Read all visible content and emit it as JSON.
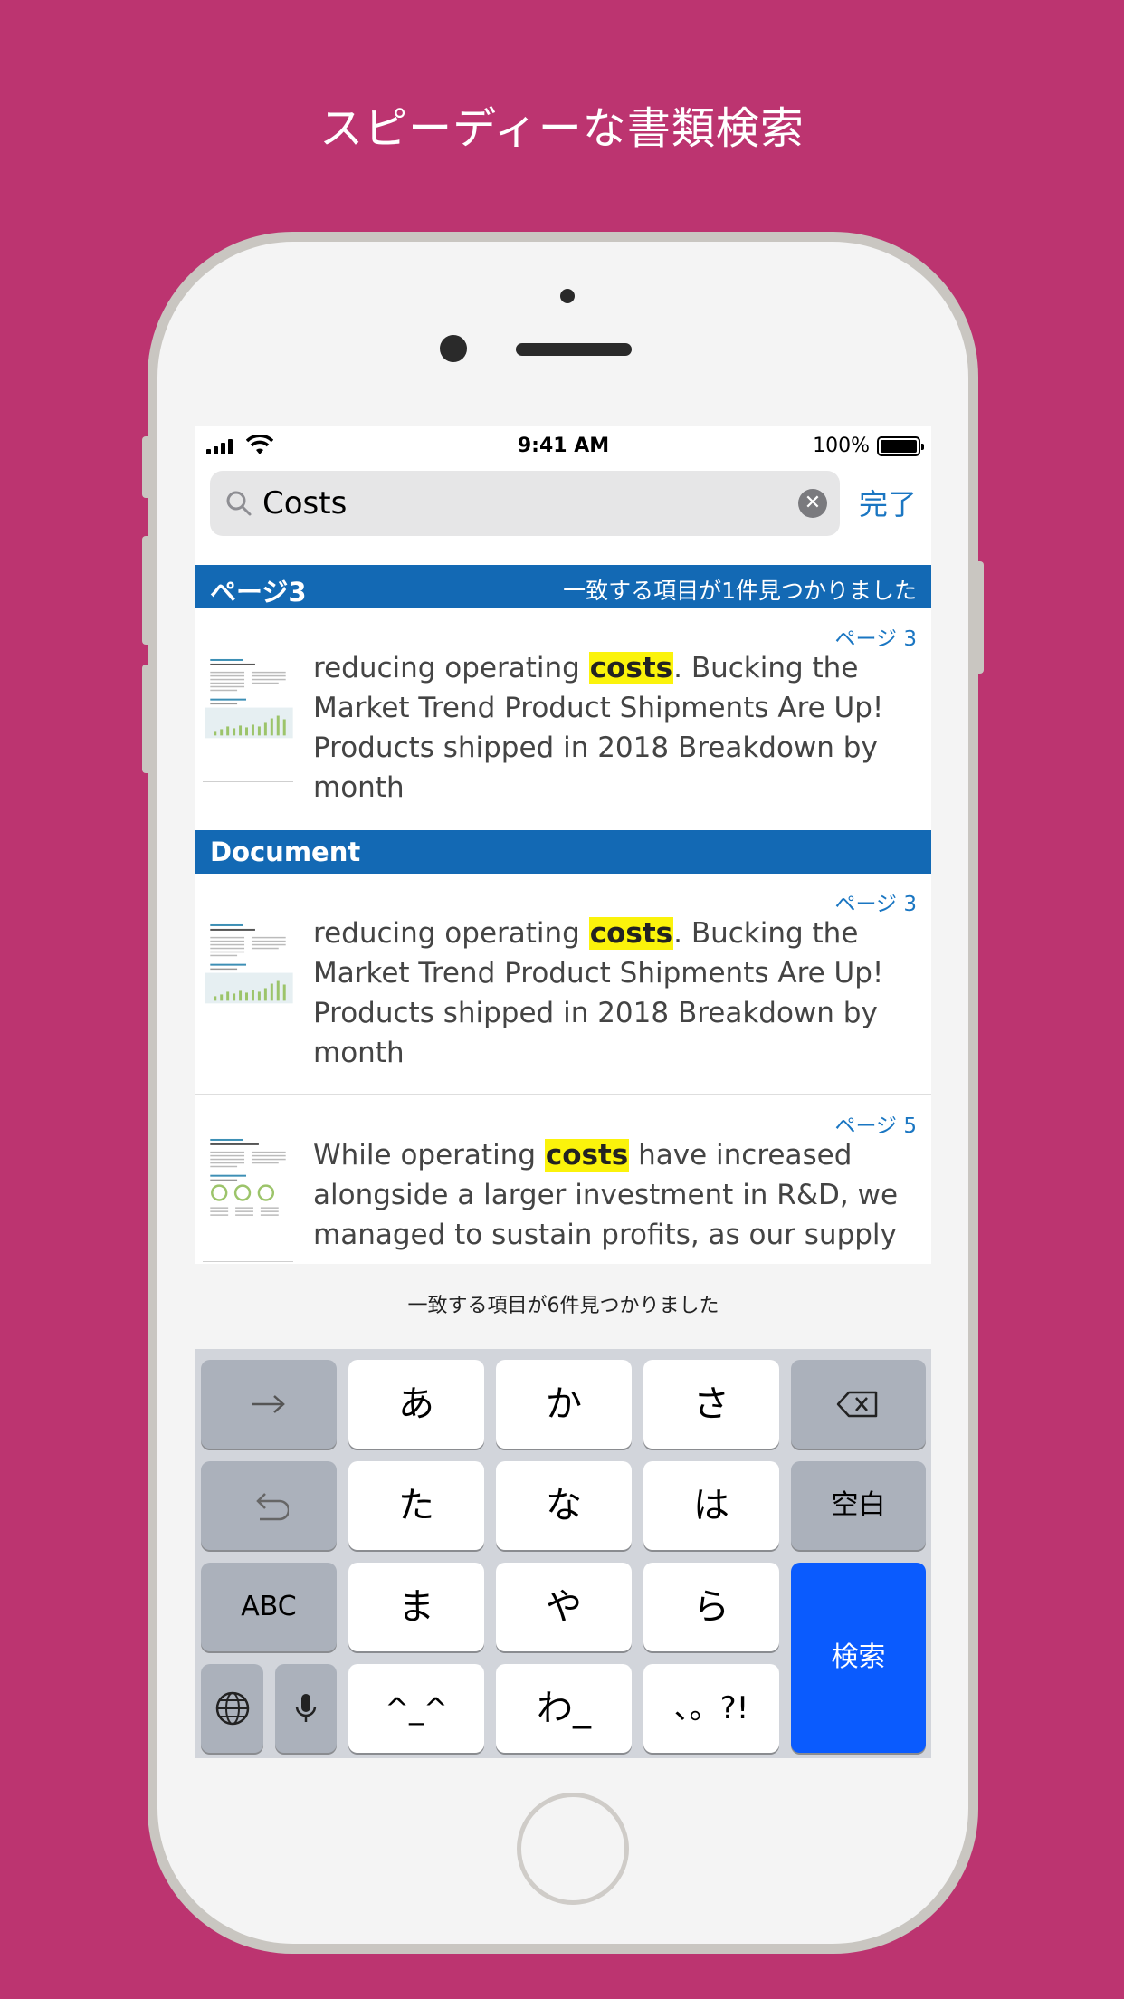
{
  "headline": "スピーディーな書類検索",
  "status_bar": {
    "time": "9:41 AM",
    "battery": "100%"
  },
  "search": {
    "query": "Costs",
    "done_label": "完了"
  },
  "sections": [
    {
      "title": "ページ3",
      "count": "一致する項目が1件見つかりました",
      "results": [
        {
          "page": "ページ 3",
          "before": "reducing operating ",
          "match": "costs",
          "after": ". Bucking the Market Trend Product Shipments Are Up! Products shipped in 2018 Breakdown by month"
        }
      ]
    },
    {
      "title": "Document",
      "results": [
        {
          "page": "ページ 3",
          "before": "reducing operating ",
          "match": "costs",
          "after": ". Bucking the Market Trend Product Shipments Are Up! Products shipped in 2018 Breakdown by month"
        },
        {
          "page": "ページ 5",
          "before": "While operating ",
          "match": "costs",
          "after": " have increased alongside a larger investment in R&D, we managed to sustain profits, as our supply"
        }
      ]
    }
  ],
  "match_summary": "一致する項目が6件見つかりました",
  "keyboard": {
    "row1": [
      "あ",
      "か",
      "さ"
    ],
    "row2": [
      "た",
      "な",
      "は"
    ],
    "space": "空白",
    "abc": "ABC",
    "row3": [
      "ま",
      "や",
      "ら"
    ],
    "row4": [
      "^_^",
      "わ_",
      "、。?!"
    ],
    "search": "検索"
  }
}
